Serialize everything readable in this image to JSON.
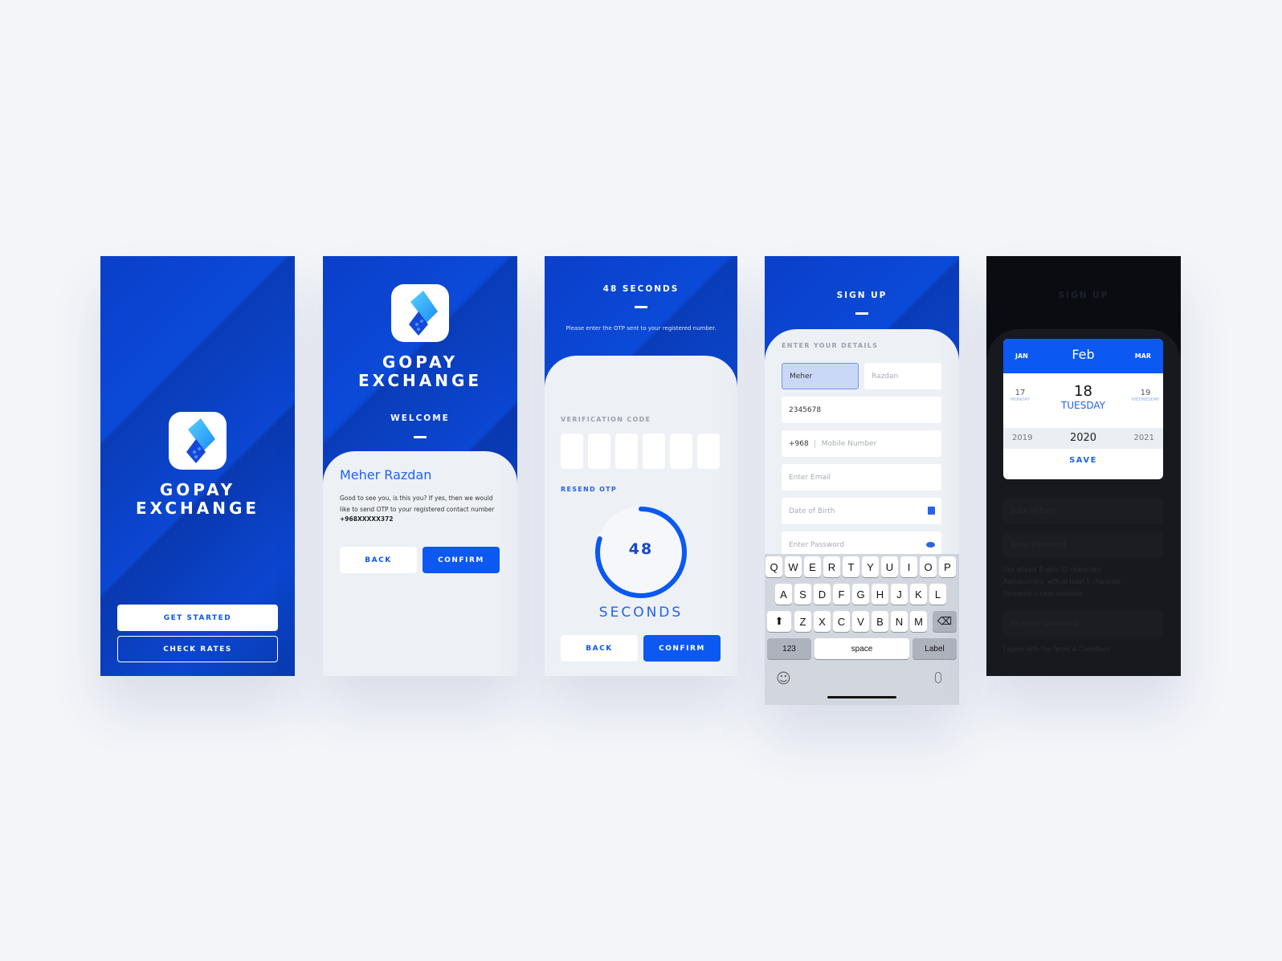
{
  "brand": {
    "line1": "GOPAY",
    "line2": "EXCHANGE",
    "accent": "#0b58f2"
  },
  "screen1": {
    "get_started": "GET STARTED",
    "check_rates": "CHECK RATES"
  },
  "screen2": {
    "welcome": "WELCOME",
    "name": "Meher Razdan",
    "message": "Good to see you, is this you? If yes, then we would like to send OTP to your registered contact number",
    "phone": "+968XXXXX372",
    "back": "BACK",
    "confirm": "CONFIRM"
  },
  "screen3": {
    "title": "48 SECONDS",
    "subtitle": "Please enter the OTP sent to your registered number.",
    "code_label": "VERIFICATION CODE",
    "resend": "RESEND OTP",
    "timer": "48",
    "timer_unit": "SECONDS",
    "timer_progress": 0.8,
    "back": "BACK",
    "confirm": "CONFIRM"
  },
  "screen4": {
    "title": "SIGN UP",
    "section": "ENTER YOUR DETAILS",
    "first_name": "Meher",
    "last_name_placeholder": "Razdan",
    "id_value": "2345678",
    "country_code": "+968",
    "mobile_placeholder": "Mobile Number",
    "email_placeholder": "Enter Email",
    "dob_placeholder": "Date of Birth",
    "password_placeholder": "Enter Password",
    "keyboard": {
      "row1": [
        "Q",
        "W",
        "E",
        "R",
        "T",
        "Y",
        "U",
        "I",
        "O",
        "P"
      ],
      "row2": [
        "A",
        "S",
        "D",
        "F",
        "G",
        "H",
        "J",
        "K",
        "L"
      ],
      "row3": [
        "Z",
        "X",
        "C",
        "V",
        "B",
        "N",
        "M"
      ],
      "numbers": "123",
      "space": "space",
      "action": "Label"
    }
  },
  "screen5": {
    "title": "SIGN UP",
    "prev_month": "JAN",
    "month": "Feb",
    "next_month": "MAR",
    "prev_day": "17",
    "prev_weekday": "MONDAY",
    "day": "18",
    "weekday": "TUESDAY",
    "next_day": "19",
    "next_weekday": "WEDNESDAY",
    "prev_year": "2019",
    "year": "2020",
    "next_year": "2021",
    "save": "SAVE",
    "dob_placeholder": "Date of Birth",
    "password_placeholder": "Enter Password",
    "rules": [
      "Use atleast 8 upto 32 characters",
      "Alphanumeric with at least 1 character",
      "Password is case sensitive"
    ],
    "reenter_placeholder": "Re-enter password",
    "terms": "I agree with the Terms & Conditions"
  }
}
